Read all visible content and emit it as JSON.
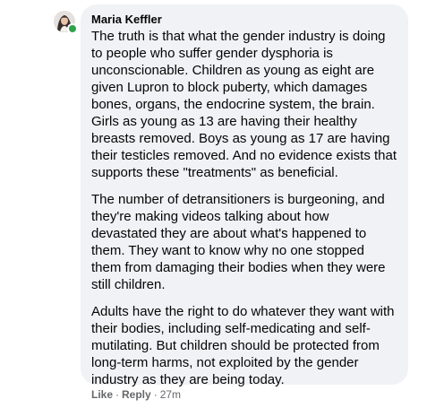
{
  "comment": {
    "author": "Maria Keffler",
    "paragraphs": [
      "The truth is that what the gender industry is doing to people who suffer gender dysphoria is unconscionable. Children as young as eight are given Lupron to block puberty, which damages bones, organs, the endocrine system, the brain. Girls as young as 13 are having their healthy breasts removed. Boys as young as 17 are having their testicles removed. And no evidence exists that supports these \"treatments\" as beneficial.",
      "The number of detransitioners is burgeoning, and they're making videos talking about how devastated they are about what's happened to them. They want to know why no one stopped them from damaging their bodies when they were still children.",
      "Adults have the right to do whatever they want with their bodies, including self-medicating and self-mutilating. But children should be protected from long-term harms, not exploited by the gender industry as they are being today."
    ],
    "online": true
  },
  "actions": {
    "like": "Like",
    "separator": "·",
    "reply": "Reply",
    "timestamp": "27m"
  },
  "colors": {
    "bubble": "#f0f2f5",
    "text": "#050505",
    "secondary_text": "#65676b",
    "online": "#31a24c"
  }
}
